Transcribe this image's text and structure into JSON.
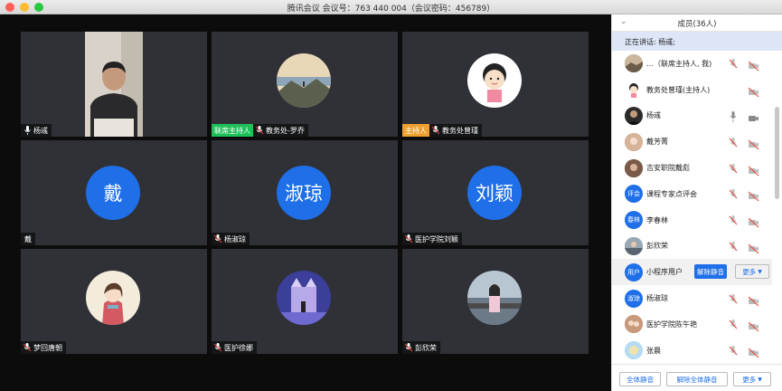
{
  "window": {
    "title": "腾讯会议 会议号：763 440 004（会议密码：456789）"
  },
  "tiles": [
    {
      "name": "杨彧",
      "tag": "",
      "avatar_text": ""
    },
    {
      "name": "教务处-罗乔",
      "tag": "联席主持人",
      "avatar_text": ""
    },
    {
      "name": "教务处曾瑾",
      "tag": "主持人",
      "avatar_text": ""
    },
    {
      "name": "戴",
      "tag": "",
      "avatar_text": "戴"
    },
    {
      "name": "杨淑琼",
      "tag": "",
      "avatar_text": "淑琼"
    },
    {
      "name": "医护学院刘颖",
      "tag": "",
      "avatar_text": "刘颖"
    },
    {
      "name": "梦回唐朝",
      "tag": "",
      "avatar_text": ""
    },
    {
      "name": "医护徐娜",
      "tag": "",
      "avatar_text": ""
    },
    {
      "name": "彭欣荣",
      "tag": "",
      "avatar_text": ""
    }
  ],
  "panel": {
    "title": "成员(36人)",
    "speaking": "正在讲话: 杨彧;",
    "members": [
      {
        "name": "…（联席主持人, 我)",
        "avatar_text": "",
        "avatar_color": "#9a8a78"
      },
      {
        "name": "教务处曾瑾(主持人)",
        "avatar_text": "",
        "avatar_color": "#ffffff"
      },
      {
        "name": "杨彧",
        "avatar_text": "",
        "avatar_color": "#2b2b2b"
      },
      {
        "name": "戴芳菁",
        "avatar_text": "",
        "avatar_color": "#b88a6a"
      },
      {
        "name": "吉安职院戴彪",
        "avatar_text": "",
        "avatar_color": "#6a4c3c"
      },
      {
        "name": "课程专家点评会",
        "avatar_text": "评会",
        "avatar_color": "#1e6fe8"
      },
      {
        "name": "李春林",
        "avatar_text": "春林",
        "avatar_color": "#1e6fe8"
      },
      {
        "name": "彭欣荣",
        "avatar_text": "",
        "avatar_color": "#7d8a99"
      },
      {
        "name": "小程序用户",
        "avatar_text": "用户",
        "avatar_color": "#1e6fe8"
      },
      {
        "name": "杨淑琼",
        "avatar_text": "淑琼",
        "avatar_color": "#1e6fe8"
      },
      {
        "name": "医护学院陈午艳",
        "avatar_text": "",
        "avatar_color": "#a87a5a"
      },
      {
        "name": "张晨",
        "avatar_text": "",
        "avatar_color": "#8fc4e8"
      }
    ],
    "unmute_label": "解除静音",
    "more_label": "更多",
    "footer": {
      "mute_all": "全体静音",
      "unmute_all": "解除全体静音",
      "more": "更多"
    }
  },
  "colors": {
    "accent": "#1e6fe8",
    "cohost_tag": "#1fc05a",
    "host_tag": "#f0a030",
    "muted": "#e0453a"
  }
}
